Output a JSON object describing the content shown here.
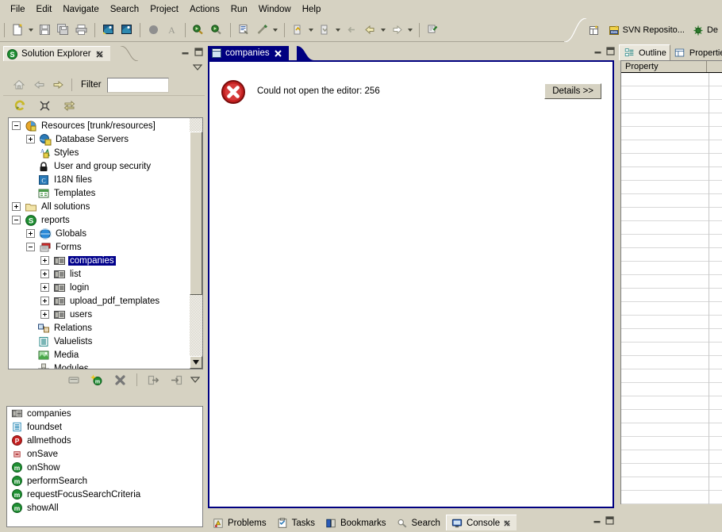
{
  "menu": {
    "items": [
      {
        "label": "File"
      },
      {
        "label": "Edit"
      },
      {
        "label": "Navigate"
      },
      {
        "label": "Search"
      },
      {
        "label": "Project"
      },
      {
        "label": "Actions"
      },
      {
        "label": "Run"
      },
      {
        "label": "Window"
      },
      {
        "label": "Help"
      }
    ]
  },
  "toolbar": {
    "buttons": [
      {
        "name": "new-wizard",
        "icon": "new-file-icon"
      },
      {
        "name": "save",
        "icon": "save-icon"
      },
      {
        "name": "save-all",
        "icon": "save-all-icon"
      },
      {
        "name": "print",
        "icon": "print-icon"
      },
      {
        "name": "i18n-a",
        "icon": "flag-icon"
      },
      {
        "name": "i18n-b",
        "icon": "flag-icon"
      },
      {
        "name": "record",
        "icon": "circle-icon"
      },
      {
        "name": "text-style",
        "icon": "letter-a-icon"
      },
      {
        "name": "debug",
        "icon": "debug-run-icon"
      },
      {
        "name": "run",
        "icon": "run-icon"
      },
      {
        "name": "servoy-client",
        "icon": "servoy-icon"
      },
      {
        "name": "link",
        "icon": "wand-icon"
      },
      {
        "name": "prev-annotation",
        "icon": "annotation-up-icon"
      },
      {
        "name": "next-annotation",
        "icon": "annotation-down-icon"
      },
      {
        "name": "back-small",
        "icon": "back-small-icon"
      },
      {
        "name": "back",
        "icon": "back-arrow-icon"
      },
      {
        "name": "forward",
        "icon": "forward-arrow-icon"
      },
      {
        "name": "open-type",
        "icon": "open-type-icon"
      }
    ]
  },
  "perspective_bar": {
    "open_perspective_tooltip": "Open Perspective",
    "items": [
      {
        "label": "SVN Reposito...",
        "icon": "svn-icon"
      },
      {
        "label": "De",
        "icon": "debug-perspective-icon"
      }
    ]
  },
  "solution_explorer": {
    "tab_label": "Solution Explorer",
    "tab_icon": "servoy-s-icon",
    "close_icon": "close-icon",
    "minimize_tooltip": "Minimize",
    "maximize_tooltip": "Maximize",
    "view_menu_tooltip": "View Menu",
    "nav_buttons": [
      {
        "name": "home-button",
        "icon": "home-icon"
      },
      {
        "name": "back-button",
        "icon": "back-arrow-icon"
      },
      {
        "name": "forward-button",
        "icon": "forward-arrow-icon"
      }
    ],
    "filter_label": "Filter",
    "filter_value": "",
    "filter_placeholder": "",
    "action_buttons": [
      {
        "name": "refresh-button",
        "icon": "refresh-icon"
      },
      {
        "name": "collapse-all-button",
        "icon": "collapse-all-icon"
      },
      {
        "name": "link-with-editor-button",
        "icon": "link-editor-icon"
      }
    ],
    "bottom_buttons": [
      {
        "name": "new-form-button",
        "icon": "form-new-icon"
      },
      {
        "name": "new-method-button",
        "icon": "method-new-icon"
      },
      {
        "name": "delete-button",
        "icon": "delete-x-icon"
      },
      {
        "name": "move-out-button",
        "icon": "move-out-icon"
      },
      {
        "name": "move-in-button",
        "icon": "move-in-icon"
      },
      {
        "name": "menu-chevron",
        "icon": "chevron-down-icon"
      }
    ],
    "tree": [
      {
        "label": "Resources [trunk/resources]",
        "depth": 0,
        "twisty": "minus",
        "icon": "resources-icon",
        "selected": false
      },
      {
        "label": "Database Servers",
        "depth": 1,
        "twisty": "plus",
        "icon": "database-servers-icon",
        "selected": false
      },
      {
        "label": "Styles",
        "depth": 1,
        "twisty": "none",
        "icon": "styles-icon",
        "selected": false
      },
      {
        "label": "User and group security",
        "depth": 1,
        "twisty": "none",
        "icon": "lock-icon",
        "selected": false
      },
      {
        "label": "I18N files",
        "depth": 1,
        "twisty": "none",
        "icon": "i18n-icon",
        "selected": false
      },
      {
        "label": "Templates",
        "depth": 1,
        "twisty": "none",
        "icon": "templates-icon",
        "selected": false
      },
      {
        "label": "All solutions",
        "depth": 0,
        "twisty": "plus",
        "icon": "folder-icon",
        "selected": false
      },
      {
        "label": "reports",
        "depth": 0,
        "twisty": "minus",
        "icon": "solution-icon",
        "selected": false
      },
      {
        "label": "Globals",
        "depth": 1,
        "twisty": "plus",
        "icon": "globals-icon",
        "selected": false
      },
      {
        "label": "Forms",
        "depth": 1,
        "twisty": "minus",
        "icon": "forms-icon",
        "selected": false
      },
      {
        "label": "companies",
        "depth": 2,
        "twisty": "plus",
        "icon": "form-icon",
        "selected": true
      },
      {
        "label": "list",
        "depth": 2,
        "twisty": "plus",
        "icon": "form-icon",
        "selected": false
      },
      {
        "label": "login",
        "depth": 2,
        "twisty": "plus",
        "icon": "form-icon",
        "selected": false
      },
      {
        "label": "upload_pdf_templates",
        "depth": 2,
        "twisty": "plus",
        "icon": "form-icon",
        "selected": false
      },
      {
        "label": "users",
        "depth": 2,
        "twisty": "plus",
        "icon": "form-icon",
        "selected": false
      },
      {
        "label": "Relations",
        "depth": 1,
        "twisty": "none",
        "icon": "relations-icon",
        "selected": false
      },
      {
        "label": "Valuelists",
        "depth": 1,
        "twisty": "none",
        "icon": "valuelists-icon",
        "selected": false
      },
      {
        "label": "Media",
        "depth": 1,
        "twisty": "none",
        "icon": "media-icon",
        "selected": false
      },
      {
        "label": "Modules",
        "depth": 1,
        "twisty": "none",
        "icon": "modules-icon",
        "selected": false
      }
    ]
  },
  "methods_view": {
    "items": [
      {
        "label": "companies",
        "icon": "form-icon"
      },
      {
        "label": "foundset",
        "icon": "foundset-icon"
      },
      {
        "label": "allmethods",
        "icon": "property-p-icon"
      },
      {
        "label": "onSave",
        "icon": "event-icon"
      },
      {
        "label": "onShow",
        "icon": "method-m-icon"
      },
      {
        "label": "performSearch",
        "icon": "method-m-icon"
      },
      {
        "label": "requestFocusSearchCriteria",
        "icon": "method-m-icon"
      },
      {
        "label": "showAll",
        "icon": "method-m-icon"
      }
    ]
  },
  "editor": {
    "tab": {
      "label": "companies",
      "icon": "form-editor-icon",
      "close_icon": "close-icon"
    },
    "minimize_tooltip": "Minimize",
    "maximize_tooltip": "Maximize",
    "error": {
      "icon": "error-icon",
      "message": "Could not open the editor: 256",
      "details_button": "Details >>"
    }
  },
  "right_view": {
    "tabs": [
      {
        "label": "Outline",
        "icon": "outline-icon",
        "active": true
      },
      {
        "label": "Propertie",
        "icon": "properties-icon",
        "active": false
      }
    ],
    "property_table": {
      "column_header": "Property",
      "rows": [
        "",
        "",
        "",
        "",
        "",
        "",
        "",
        "",
        "",
        "",
        "",
        "",
        "",
        "",
        "",
        "",
        "",
        "",
        "",
        "",
        "",
        "",
        "",
        "",
        "",
        "",
        "",
        "",
        "",
        "",
        "",
        ""
      ]
    }
  },
  "bottom_view": {
    "tabs": [
      {
        "label": "Problems",
        "icon": "problems-icon",
        "active": false,
        "close": false
      },
      {
        "label": "Tasks",
        "icon": "tasks-icon",
        "active": false,
        "close": false
      },
      {
        "label": "Bookmarks",
        "icon": "bookmarks-icon",
        "active": false,
        "close": false
      },
      {
        "label": "Search",
        "icon": "search-icon",
        "active": false,
        "close": false
      },
      {
        "label": "Console",
        "icon": "console-icon",
        "active": true,
        "close": true
      }
    ],
    "close_icon": "close-icon",
    "minimize_tooltip": "Minimize",
    "maximize_tooltip": "Maximize"
  },
  "colors": {
    "chrome": "#d6d2c2",
    "active_tab_bg": "#e9e6db",
    "editor_tab_bg": "#000080",
    "selection_bg": "#00008b",
    "error_red": "#c42020",
    "method_green": "#1f8f32"
  }
}
